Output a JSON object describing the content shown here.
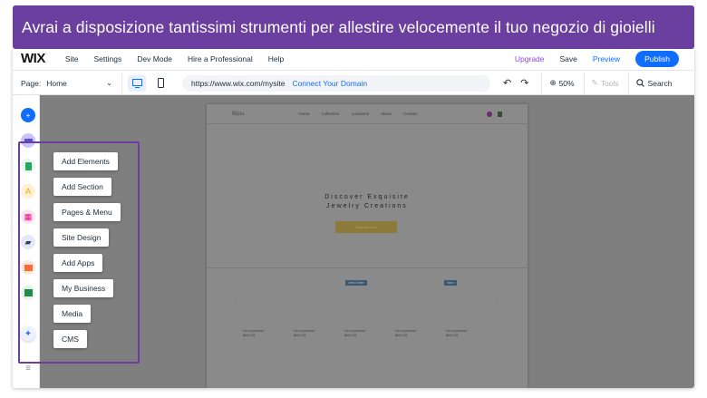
{
  "banner": {
    "text": "Avrai a disposizione tantissimi strumenti per allestire velocemente il tuo negozio di gioielli"
  },
  "topbar": {
    "logo": "WIX",
    "menu": [
      "Site",
      "Settings",
      "Dev Mode",
      "Hire a Professional",
      "Help"
    ],
    "upgrade": "Upgrade",
    "save": "Save",
    "preview": "Preview",
    "publish": "Publish"
  },
  "toolbar": {
    "page_label": "Page:",
    "page_value": "Home",
    "url": "https://www.wix.com/mysite",
    "connect_domain": "Connect Your Domain",
    "zoom": "50%",
    "tools": "Tools",
    "search": "Search"
  },
  "site": {
    "logo": "Bijou",
    "nav": [
      "Home",
      "Collection",
      "Locations",
      "About",
      "Contact"
    ],
    "hero_title_line1": "Discover Exquisite",
    "hero_title_line2": "Jewelry Creations",
    "hero_button": "Explore Now",
    "tags": [
      "Best Seller",
      "New"
    ],
    "products": [
      {
        "name": "I'm a product",
        "price": "₪25.00"
      },
      {
        "name": "I'm a product",
        "price": "₪25.00"
      },
      {
        "name": "I'm a product",
        "price": "₪25.00"
      },
      {
        "name": "I'm a product",
        "price": "₪25.00"
      },
      {
        "name": "I'm a product",
        "price": "₪25.00"
      }
    ]
  },
  "panel": {
    "items": [
      "Add Elements",
      "Add Section",
      "Pages & Menu",
      "Site Design",
      "Add Apps",
      "My Business",
      "Media",
      "CMS"
    ]
  },
  "colors": {
    "banner": "#6b3fa0",
    "publish": "#116dff",
    "upgrade": "#8e4bd8"
  }
}
